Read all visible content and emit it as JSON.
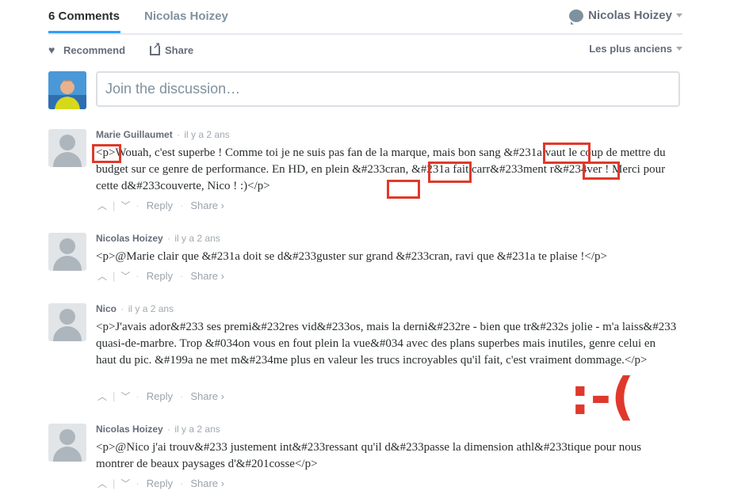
{
  "header": {
    "comments_tab": "6 Comments",
    "site_tab": "Nicolas Hoizey",
    "user_name": "Nicolas Hoizey"
  },
  "actions": {
    "recommend": "Recommend",
    "share": "Share",
    "sort": "Les plus anciens"
  },
  "compose": {
    "placeholder": "Join the discussion…"
  },
  "comments": [
    {
      "author": "Marie Guillaumet",
      "time": "il y a 2 ans",
      "text": "<p>Wouah, c'est superbe ! Comme toi je ne suis pas fan de la marque, mais bon sang &#231a vaut le coup de mettre du budget sur ce genre de performance. En HD, en plein &#233cran, &#231a fait carr&#233ment r&#234ver ! Merci pour cette d&#233couverte, Nico ! :)</p>",
      "reply": "Reply",
      "share": "Share ›"
    },
    {
      "author": "Nicolas Hoizey",
      "time": "il y a 2 ans",
      "text": "<p>@Marie clair que &#231a doit se d&#233guster sur grand &#233cran, ravi que &#231a te plaise !</p>",
      "reply": "Reply",
      "share": "Share ›"
    },
    {
      "author": "Nico",
      "time": "il y a 2 ans",
      "text": "<p>J'avais ador&#233 ses premi&#232res vid&#233os, mais la derni&#232re - bien que tr&#232s jolie - m'a laiss&#233 quasi-de-marbre. Trop &#034on vous en fout plein la vue&#034 avec des plans superbes mais inutiles, genre celui en haut du pic. &#199a ne met m&#234me plus en valeur les trucs incroyables qu'il fait, c'est vraiment dommage.</p>",
      "reply": "Reply",
      "share": "Share ›"
    },
    {
      "author": "Nicolas Hoizey",
      "time": "il y a 2 ans",
      "text": "<p>@Nico j'ai trouv&#233 justement int&#233ressant qu'il d&#233passe la dimension athl&#233tique pour nous montrer de beaux paysages d'&#201cosse</p>",
      "reply": "Reply",
      "share": "Share ›"
    }
  ],
  "annotation": {
    "emoticon": ":-(",
    "color": "#e0392b"
  },
  "colors": {
    "accent": "#2e9fff",
    "muted": "#656c7a"
  }
}
